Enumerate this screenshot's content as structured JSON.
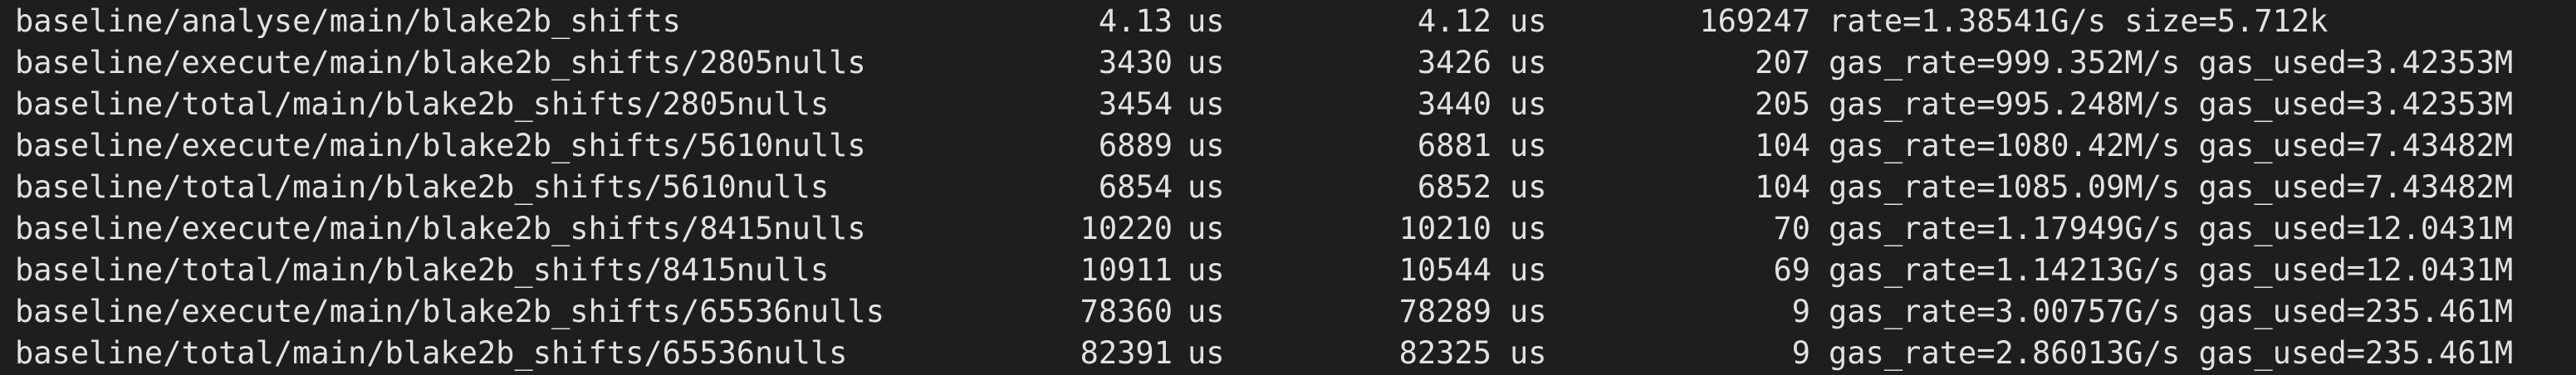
{
  "terminal": {
    "rows": [
      {
        "name": "baseline/analyse/main/blake2b_shifts",
        "time1": "4.13",
        "unit1": "us",
        "time2": "4.12",
        "unit2": "us",
        "iterations": "169247",
        "extra": "rate=1.38541G/s size=5.712k"
      },
      {
        "name": "baseline/execute/main/blake2b_shifts/2805nulls",
        "time1": "3430",
        "unit1": "us",
        "time2": "3426",
        "unit2": "us",
        "iterations": "207",
        "extra": "gas_rate=999.352M/s gas_used=3.42353M"
      },
      {
        "name": "baseline/total/main/blake2b_shifts/2805nulls",
        "time1": "3454",
        "unit1": "us",
        "time2": "3440",
        "unit2": "us",
        "iterations": "205",
        "extra": "gas_rate=995.248M/s gas_used=3.42353M"
      },
      {
        "name": "baseline/execute/main/blake2b_shifts/5610nulls",
        "time1": "6889",
        "unit1": "us",
        "time2": "6881",
        "unit2": "us",
        "iterations": "104",
        "extra": "gas_rate=1080.42M/s gas_used=7.43482M"
      },
      {
        "name": "baseline/total/main/blake2b_shifts/5610nulls",
        "time1": "6854",
        "unit1": "us",
        "time2": "6852",
        "unit2": "us",
        "iterations": "104",
        "extra": "gas_rate=1085.09M/s gas_used=7.43482M"
      },
      {
        "name": "baseline/execute/main/blake2b_shifts/8415nulls",
        "time1": "10220",
        "unit1": "us",
        "time2": "10210",
        "unit2": "us",
        "iterations": "70",
        "extra": "gas_rate=1.17949G/s gas_used=12.0431M"
      },
      {
        "name": "baseline/total/main/blake2b_shifts/8415nulls",
        "time1": "10911",
        "unit1": "us",
        "time2": "10544",
        "unit2": "us",
        "iterations": "69",
        "extra": "gas_rate=1.14213G/s gas_used=12.0431M"
      },
      {
        "name": "baseline/execute/main/blake2b_shifts/65536nulls",
        "time1": "78360",
        "unit1": "us",
        "time2": "78289",
        "unit2": "us",
        "iterations": "9",
        "extra": "gas_rate=3.00757G/s gas_used=235.461M"
      },
      {
        "name": "baseline/total/main/blake2b_shifts/65536nulls",
        "time1": "82391",
        "unit1": "us",
        "time2": "82325",
        "unit2": "us",
        "iterations": "9",
        "extra": "gas_rate=2.86013G/s gas_used=235.461M"
      }
    ]
  }
}
